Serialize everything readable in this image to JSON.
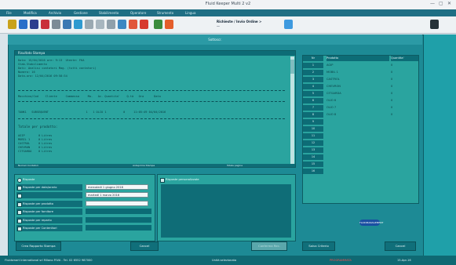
{
  "window": {
    "title": "Fluid Keeper Multi 2 v2"
  },
  "menu": [
    "File",
    "Modifica",
    "Archivio",
    "Gestione",
    "Stabilimento",
    "Operatore",
    "Strumento",
    "Lingua"
  ],
  "toolbar": {
    "label_top": "Richieste / Invio Ordine >",
    "label_bottom": "—"
  },
  "dialog": {
    "header": "Sottoscr.",
    "report": {
      "title": "Risultato Stampa",
      "lines": [
        "Data: 15/04/2016 ore: 9:13  Utente: FKA",
        "Stab.Stabilimento",
        "Dati: Analisi contatori Mag. (tutti contatori)",
        "Numero: 16",
        "Data-ora: 12/04/2016 09:58:34"
      ],
      "col_header": "Macchina/Cod    Cliente     Commessa     Ma.   Ac. Quantita'    Q.tà   Ora      Data",
      "data_line": "TANK1   SUBSEQUENT                      1   1 OLIO 1          0     11:05:49 04/04/2016",
      "section": "Totale per prodotto:",
      "totals": [
        "AGIP        0 Litres",
        "MOBIL 1     0 Litres",
        "CASTROL     0 Litres",
        "CHEVRON     0 Litres",
        "CITGARDA    0 Litres"
      ],
      "footer_left": "Numeri Contatori",
      "footer_mid": "Anteprima Stampa",
      "footer_right": "Totale pagine"
    },
    "options": {
      "title": "Risposte",
      "rows": [
        {
          "label": "Risposte per data/orario",
          "checked": true
        },
        {
          "label": "",
          "checked": false
        },
        {
          "label": "Risposte per prodotto",
          "checked": false
        },
        {
          "label": "Risposte per fornitore",
          "checked": false
        },
        {
          "label": "Risposte per reparto",
          "checked": true
        },
        {
          "label": "Risposte per Contenitori",
          "checked": false
        }
      ],
      "date_from": "mercoledì  1  giugno  2016",
      "date_to": "martedì  1  marzo  2016",
      "right_title": "Risposte personalizzate"
    },
    "buttons": {
      "report": "Crea Rapporto Stampa",
      "cancel": "Cancel",
      "ok": "Conferma Rec.",
      "confirm": "Salva Criterio",
      "close": "Cancel"
    },
    "table": {
      "headers": [
        "Nr",
        "Prodotto",
        "Quantita'"
      ],
      "rows": [
        {
          "nr": "1",
          "name": "AGIP",
          "q": "0"
        },
        {
          "nr": "2",
          "name": "MOBIL 1",
          "q": "0"
        },
        {
          "nr": "3",
          "name": "CASTROL",
          "q": "0"
        },
        {
          "nr": "4",
          "name": "CHEVRON",
          "q": "0"
        },
        {
          "nr": "5",
          "name": "CITGARDA",
          "q": "0"
        },
        {
          "nr": "6",
          "name": "OLIO 6",
          "q": "0"
        },
        {
          "nr": "7",
          "name": "OLIO 7",
          "q": "0"
        },
        {
          "nr": "8",
          "name": "OLIO 8",
          "q": "0"
        },
        {
          "nr": "9",
          "name": "",
          "q": ""
        },
        {
          "nr": "10",
          "name": "",
          "q": ""
        },
        {
          "nr": "11",
          "name": "",
          "q": ""
        },
        {
          "nr": "12",
          "name": "",
          "q": ""
        },
        {
          "nr": "13",
          "name": "",
          "q": ""
        },
        {
          "nr": "14",
          "name": "",
          "q": ""
        },
        {
          "nr": "15",
          "name": "",
          "q": ""
        },
        {
          "nr": "16",
          "name": "",
          "q": ""
        }
      ]
    },
    "logo": "FLUIDMANAGEMENT"
  },
  "status": {
    "left": "Fluidsmart International srl Milano P.IVA - Tel. 02 6552 987000",
    "mid": "Unità selezionata",
    "right_red": "PROGRAMMATA",
    "date": "15-Apr-16"
  }
}
